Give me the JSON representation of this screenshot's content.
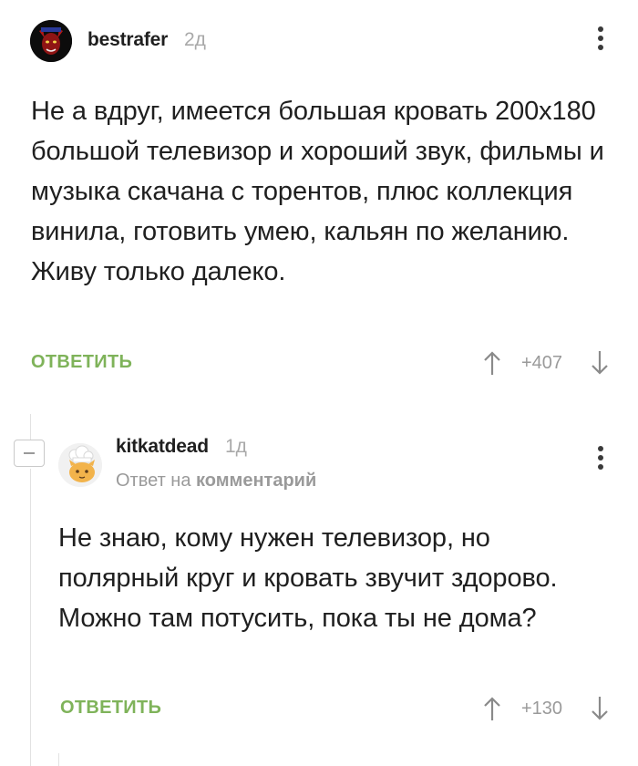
{
  "comments": [
    {
      "author": "bestrafer",
      "time": "2д",
      "avatar": "dark-demon-avatar",
      "text": "Не а вдруг, имеется большая кровать 200х180 большой телевизор и хороший звук, фильмы и музыка скачана с торентов, плюс коллекция винила, готовить умею, кальян по желанию. Живу только далеко.",
      "reply_label": "ОТВЕТИТЬ",
      "rating": "+407"
    },
    {
      "author": "kitkatdead",
      "time": "1д",
      "avatar": "chef-cat-avatar",
      "reply_prefix": "Ответ на",
      "reply_link": "комментарий",
      "text": "Не знаю, кому нужен телевизор, но полярный круг и кровать звучит здорово. Можно там потусить, пока ты не дома?",
      "reply_label": "ОТВЕТИТЬ",
      "rating": "+130"
    }
  ],
  "icons": {
    "more": "more-vertical-icon",
    "up": "arrow-up-icon",
    "down": "arrow-down-icon",
    "collapse": "minus-icon"
  },
  "colors": {
    "accent_green": "#7fb35a",
    "muted": "#9a9a9a",
    "text": "#1f1f1f"
  }
}
